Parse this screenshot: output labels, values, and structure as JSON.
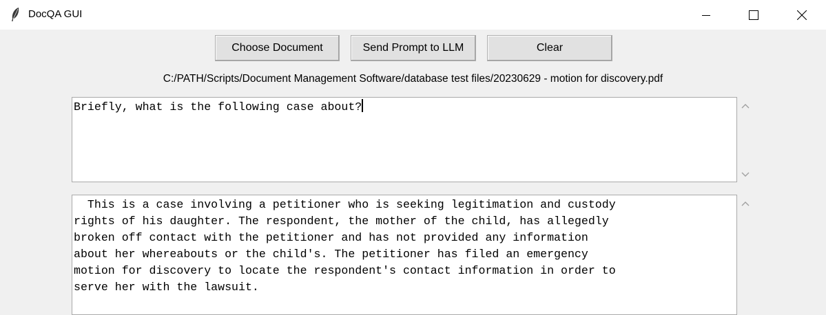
{
  "window": {
    "title": "DocQA GUI"
  },
  "toolbar": {
    "choose_label": "Choose Document",
    "send_label": "Send Prompt to LLM",
    "clear_label": "Clear"
  },
  "file_path": "C:/PATH/Scripts/Document Management Software/database test files/20230629 - motion for discovery.pdf",
  "prompt": {
    "text": "Briefly, what is the following case about?"
  },
  "response": {
    "text": "  This is a case involving a petitioner who is seeking legitimation and custody\nrights of his daughter. The respondent, the mother of the child, has allegedly\nbroken off contact with the petitioner and has not provided any information\nabout her whereabouts or the child's. The petitioner has filed an emergency\nmotion for discovery to locate the respondent's contact information in order to\nserve her with the lawsuit."
  },
  "icons": {
    "app": "feather-icon",
    "minimize": "minimize-icon",
    "maximize": "maximize-icon",
    "close": "close-icon",
    "scroll_up": "chevron-up-icon",
    "scroll_down": "chevron-down-icon"
  }
}
